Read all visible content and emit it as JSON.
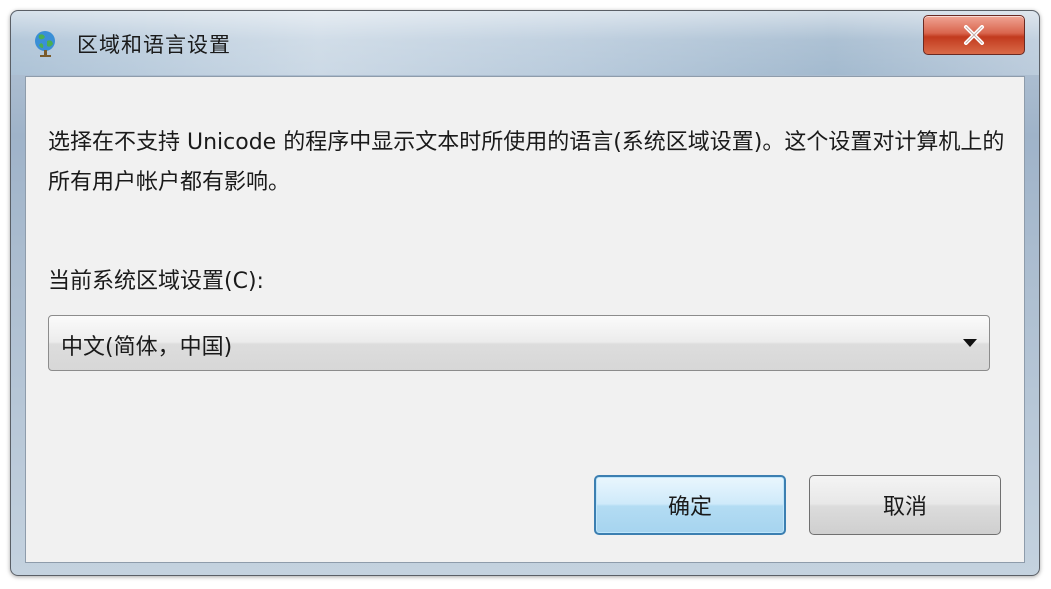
{
  "window": {
    "title": "区域和语言设置",
    "close_label": "X"
  },
  "dialog": {
    "description": "选择在不支持 Unicode 的程序中显示文本时所使用的语言(系统区域设置)。这个设置对计算机上的所有用户帐户都有影响。",
    "locale_label": "当前系统区域设置(C):",
    "locale_selected": "中文(简体，中国)",
    "ok_label": "确定",
    "cancel_label": "取消"
  },
  "colors": {
    "close_button": "#c23a1e",
    "ok_button_border": "#3c7fb1",
    "client_background": "#f1f1f1"
  },
  "icons": {
    "title_icon": "globe-icon",
    "close_icon": "close-icon",
    "dropdown_icon": "chevron-down-icon"
  }
}
